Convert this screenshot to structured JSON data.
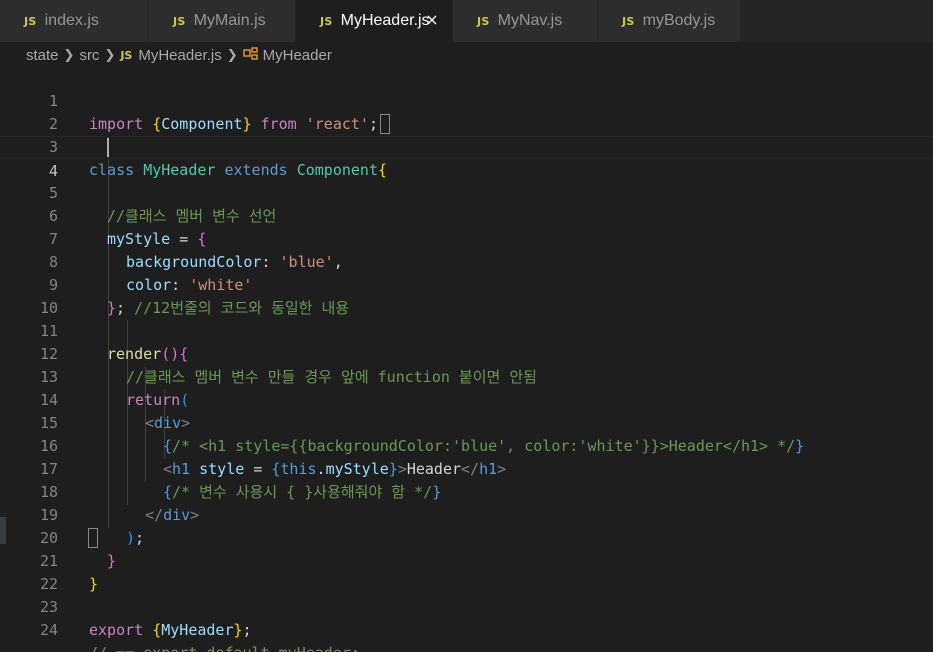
{
  "tabs": [
    {
      "icon": "JS",
      "label": "index.js",
      "active": false
    },
    {
      "icon": "JS",
      "label": "MyMain.js",
      "active": false
    },
    {
      "icon": "JS",
      "label": "MyHeader.js",
      "active": true
    },
    {
      "icon": "JS",
      "label": "MyNav.js",
      "active": false
    },
    {
      "icon": "JS",
      "label": "myBody.js",
      "active": false
    }
  ],
  "breadcrumb": {
    "items": [
      "state",
      "src",
      "MyHeader.js",
      "MyHeader"
    ],
    "file_icon": "JS",
    "symbol_icon": "class-symbol-icon"
  },
  "editor": {
    "line_numbers": [
      "1",
      "2",
      "3",
      "4",
      "5",
      "6",
      "7",
      "8",
      "9",
      "10",
      "11",
      "12",
      "13",
      "14",
      "15",
      "16",
      "17",
      "18",
      "19",
      "20",
      "21",
      "22",
      "23",
      "24"
    ],
    "current_line": 4,
    "lines": [
      "import {Component} from 'react';",
      "",
      "class MyHeader extends Component{",
      "",
      "  //클래스 멤버 변수 선언",
      "  myStyle = {",
      "    backgroundColor: 'blue',",
      "    color: 'white'",
      "  }; //12번줄의 코드와 동일한 내용",
      "",
      "  render(){",
      "    //클래스 멤버 변수 만들 경우 앞에 function 붙이면 안됨",
      "    return(",
      "      <div>",
      "        {/* <h1 style={{backgroundColor:'blue', color:'white'}}>Header</h1> */}",
      "        <h1 style = {this.myStyle}>Header</h1>",
      "        {/* 변수 사용시 { }사용해줘야 함 */}",
      "      </div>",
      "    );",
      "  }",
      "}",
      "",
      "export {MyHeader};",
      "// == export default myHeader;"
    ]
  },
  "colors": {
    "background": "#1e1e1e",
    "keyword": "#569cd6",
    "control": "#c586c0",
    "string": "#ce9178",
    "class": "#4ec9b0",
    "variable": "#9cdcfe",
    "function": "#dcdcaa",
    "comment": "#6a9955"
  }
}
